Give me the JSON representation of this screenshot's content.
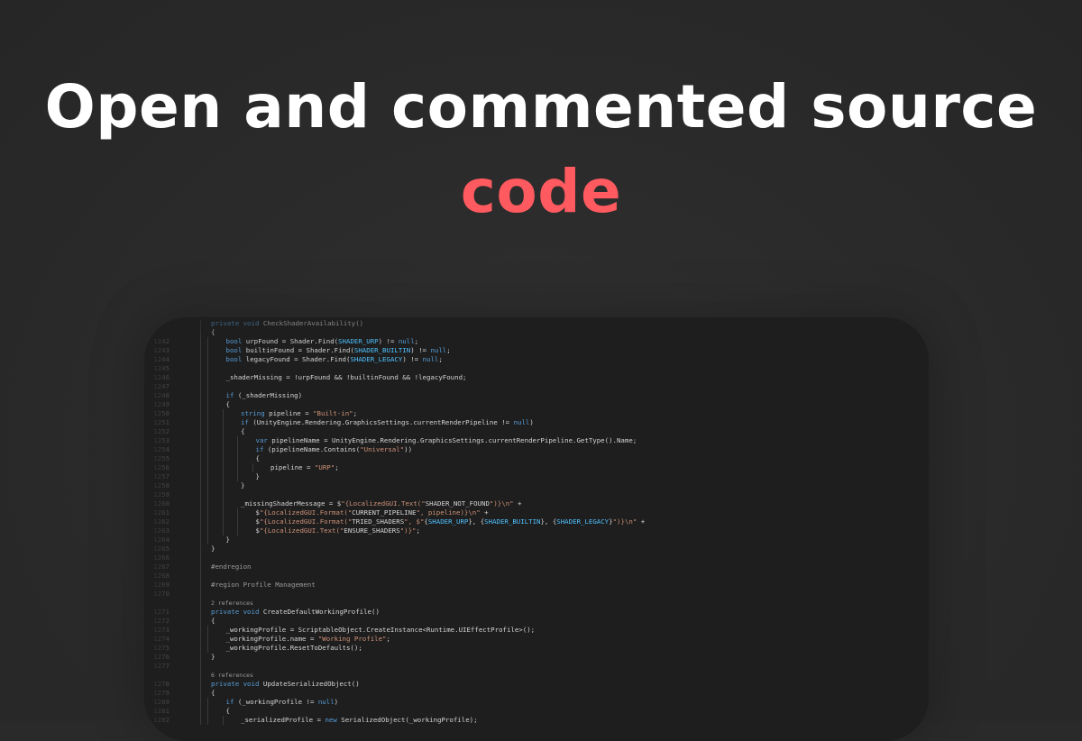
{
  "hero": {
    "title_line1": "Open and commented source",
    "title_line2": "code",
    "accent_color": "#ff5a5f"
  },
  "code": {
    "lines": [
      {
        "num": "",
        "indent": 2,
        "kind": "code",
        "text": "private void CheckShaderAvailability()"
      },
      {
        "num": "",
        "indent": 2,
        "kind": "code",
        "text": "{"
      },
      {
        "num": "1242",
        "indent": 3,
        "kind": "code",
        "text": "bool urpFound = Shader.Find(SHADER_URP) != null;"
      },
      {
        "num": "1243",
        "indent": 3,
        "kind": "code",
        "text": "bool builtinFound = Shader.Find(SHADER_BUILTIN) != null;"
      },
      {
        "num": "1244",
        "indent": 3,
        "kind": "code",
        "text": "bool legacyFound = Shader.Find(SHADER_LEGACY) != null;"
      },
      {
        "num": "1245",
        "indent": 3,
        "kind": "code",
        "text": ""
      },
      {
        "num": "1246",
        "indent": 3,
        "kind": "code",
        "text": "_shaderMissing = !urpFound && !builtinFound && !legacyFound;"
      },
      {
        "num": "1247",
        "indent": 3,
        "kind": "code",
        "text": ""
      },
      {
        "num": "1248",
        "indent": 3,
        "kind": "code",
        "text": "if (_shaderMissing)"
      },
      {
        "num": "1249",
        "indent": 3,
        "kind": "code",
        "text": "{"
      },
      {
        "num": "1250",
        "indent": 4,
        "kind": "code",
        "text": "string pipeline = \"Built-in\";"
      },
      {
        "num": "1251",
        "indent": 4,
        "kind": "code",
        "text": "if (UnityEngine.Rendering.GraphicsSettings.currentRenderPipeline != null)"
      },
      {
        "num": "1252",
        "indent": 4,
        "kind": "code",
        "text": "{"
      },
      {
        "num": "1253",
        "indent": 5,
        "kind": "code",
        "text": "var pipelineName = UnityEngine.Rendering.GraphicsSettings.currentRenderPipeline.GetType().Name;"
      },
      {
        "num": "1254",
        "indent": 5,
        "kind": "code",
        "text": "if (pipelineName.Contains(\"Universal\"))"
      },
      {
        "num": "1255",
        "indent": 5,
        "kind": "code",
        "text": "{"
      },
      {
        "num": "1256",
        "indent": 6,
        "kind": "code",
        "text": "pipeline = \"URP\";"
      },
      {
        "num": "1257",
        "indent": 5,
        "kind": "code",
        "text": "}"
      },
      {
        "num": "1258",
        "indent": 4,
        "kind": "code",
        "text": "}"
      },
      {
        "num": "1259",
        "indent": 4,
        "kind": "code",
        "text": ""
      },
      {
        "num": "1260",
        "indent": 4,
        "kind": "code",
        "text": "_missingShaderMessage = $\"{LocalizedGUI.Text(\"SHADER_NOT_FOUND\")}\\n\" +"
      },
      {
        "num": "1261",
        "indent": 5,
        "kind": "code",
        "text": "$\"{LocalizedGUI.Format(\"CURRENT_PIPELINE\", pipeline)}\\n\" +"
      },
      {
        "num": "1262",
        "indent": 5,
        "kind": "code",
        "text": "$\"{LocalizedGUI.Format(\"TRIED_SHADERS\", $\"{SHADER_URP}, {SHADER_BUILTIN}, {SHADER_LEGACY}\")}\\n\" +"
      },
      {
        "num": "1263",
        "indent": 5,
        "kind": "code",
        "text": "$\"{LocalizedGUI.Text(\"ENSURE_SHADERS\")}\";"
      },
      {
        "num": "1264",
        "indent": 3,
        "kind": "code",
        "text": "}"
      },
      {
        "num": "1265",
        "indent": 2,
        "kind": "code",
        "text": "}"
      },
      {
        "num": "1266",
        "indent": 2,
        "kind": "code",
        "text": ""
      },
      {
        "num": "1267",
        "indent": 2,
        "kind": "code",
        "text": "#endregion"
      },
      {
        "num": "1268",
        "indent": 2,
        "kind": "code",
        "text": ""
      },
      {
        "num": "1269",
        "indent": 2,
        "kind": "code",
        "text": "#region Profile Management"
      },
      {
        "num": "1270",
        "indent": 2,
        "kind": "code",
        "text": ""
      },
      {
        "num": "",
        "indent": 2,
        "kind": "refs",
        "text": "2 references"
      },
      {
        "num": "1271",
        "indent": 2,
        "kind": "code",
        "text": "private void CreateDefaultWorkingProfile()"
      },
      {
        "num": "1272",
        "indent": 2,
        "kind": "code",
        "text": "{"
      },
      {
        "num": "1273",
        "indent": 3,
        "kind": "code",
        "text": "_workingProfile = ScriptableObject.CreateInstance<Runtime.UIEffectProfile>();"
      },
      {
        "num": "1274",
        "indent": 3,
        "kind": "code",
        "text": "_workingProfile.name = \"Working Profile\";"
      },
      {
        "num": "1275",
        "indent": 3,
        "kind": "code",
        "text": "_workingProfile.ResetToDefaults();"
      },
      {
        "num": "1276",
        "indent": 2,
        "kind": "code",
        "text": "}"
      },
      {
        "num": "1277",
        "indent": 2,
        "kind": "code",
        "text": ""
      },
      {
        "num": "",
        "indent": 2,
        "kind": "refs",
        "text": "6 references"
      },
      {
        "num": "1278",
        "indent": 2,
        "kind": "code",
        "text": "private void UpdateSerializedObject()"
      },
      {
        "num": "1279",
        "indent": 2,
        "kind": "code",
        "text": "{"
      },
      {
        "num": "1280",
        "indent": 3,
        "kind": "code",
        "text": "if (_workingProfile != null)"
      },
      {
        "num": "1281",
        "indent": 3,
        "kind": "code",
        "text": "{"
      },
      {
        "num": "1282",
        "indent": 4,
        "kind": "code",
        "text": "_serializedProfile = new SerializedObject(_workingProfile);"
      }
    ]
  }
}
